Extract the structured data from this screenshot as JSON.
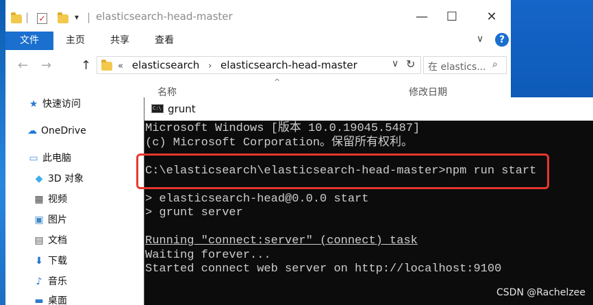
{
  "explorer": {
    "title": "elasticsearch-head-master",
    "quick_access_dropdown": "▾",
    "window_controls": {
      "minimize": "—",
      "maximize": "☐",
      "close": "✕"
    },
    "ribbon": {
      "tabs": [
        "文件",
        "主页",
        "共享",
        "查看"
      ],
      "chevron": "∨",
      "help": "?"
    },
    "nav": {
      "back": "←",
      "forward": "→",
      "up": "↑"
    },
    "address": {
      "overflow": "«",
      "crumbs": [
        "elasticsearch",
        "elasticsearch-head-master"
      ],
      "separator": "›",
      "dropdown": "∨",
      "refresh": "↻"
    },
    "search": {
      "placeholder": "在 elastics...",
      "icon": "search-icon"
    },
    "list_header": {
      "name": "名称",
      "date": "修改日期",
      "sort": "^"
    },
    "navpane": [
      {
        "label": "快速访问",
        "icon": "star-icon"
      },
      {
        "label": "OneDrive",
        "icon": "cloud-icon"
      },
      {
        "label": "此电脑",
        "icon": "computer-icon"
      },
      {
        "label": "3D 对象",
        "icon": "cube-icon"
      },
      {
        "label": "视频",
        "icon": "film-icon"
      },
      {
        "label": "图片",
        "icon": "image-icon"
      },
      {
        "label": "文档",
        "icon": "document-icon"
      },
      {
        "label": "下载",
        "icon": "download-icon"
      },
      {
        "label": "音乐",
        "icon": "music-icon"
      },
      {
        "label": "桌面",
        "icon": "desktop-icon"
      }
    ]
  },
  "console": {
    "title": "grunt",
    "icon_text": "C:\\",
    "lines": [
      "Microsoft Windows [版本 10.0.19045.5487]",
      "(c) Microsoft Corporation。保留所有权利。",
      "",
      "C:\\elasticsearch\\elasticsearch-head-master>npm run start",
      "",
      "> elasticsearch-head@0.0.0 start",
      "> grunt server",
      "",
      "Running \"connect:server\" (connect) task",
      "Waiting forever...",
      "Started connect web server on http://localhost:9100"
    ],
    "underlined_line": 8,
    "highlight_color": "#e8372c"
  },
  "watermark": "CSDN @Rachelzee",
  "colors": {
    "accent": "#1a6fcf",
    "console_bg": "#0c0c0c",
    "console_fg": "#cccccc"
  }
}
